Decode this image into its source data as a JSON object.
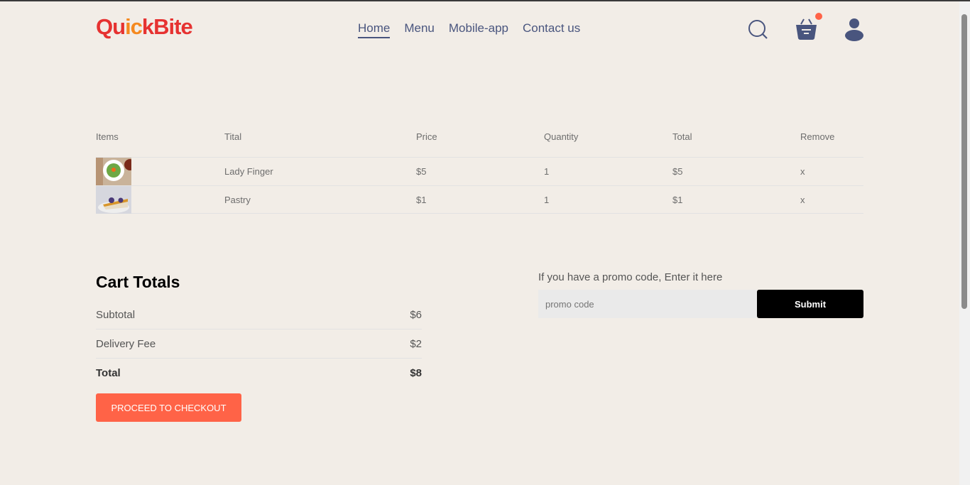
{
  "header": {
    "logo": {
      "part1": "Qu",
      "part2": "ic",
      "part3": "kBite"
    },
    "nav": [
      "Home",
      "Menu",
      "Mobile-app",
      "Contact us"
    ],
    "active": "Home",
    "icons": [
      "search-icon",
      "basket-icon",
      "user-icon"
    ],
    "cart_badge_color": "#ff6347"
  },
  "table": {
    "headers": [
      "Items",
      "Tital",
      "Price",
      "Quantity",
      "Total",
      "Remove"
    ],
    "rows": [
      {
        "title": "Lady Finger",
        "price": "$5",
        "quantity": "1",
        "total": "$5",
        "remove": "x"
      },
      {
        "title": "Pastry",
        "price": "$1",
        "quantity": "1",
        "total": "$1",
        "remove": "x"
      }
    ]
  },
  "cart": {
    "title": "Cart Totals",
    "subtotal_label": "Subtotal",
    "subtotal": "$6",
    "delivery_label": "Delivery Fee",
    "delivery": "$2",
    "total_label": "Total",
    "total": "$8",
    "checkout": "PROCEED TO CHECKOUT"
  },
  "promo": {
    "label": "If you have a promo code, Enter it here",
    "placeholder": "promo code",
    "submit": "Submit"
  },
  "colors": {
    "accent": "#ff6347",
    "nav": "#49557e",
    "background": "#f2ede7"
  }
}
